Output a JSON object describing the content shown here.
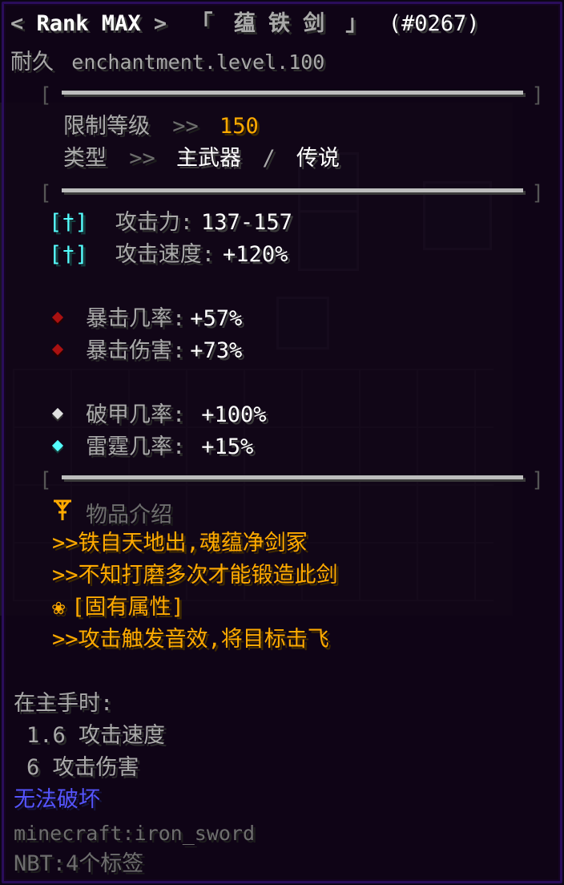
{
  "colors": {
    "gold": "#ffaa00",
    "gray": "#a9a9a9",
    "aqua": "#55ffff",
    "blue": "#5555ff",
    "red": "#aa0000",
    "frame": "#2a0d5a"
  },
  "header": {
    "left_arrow": "<",
    "rank": "Rank MAX",
    "right_arrow": ">",
    "bracket_open": "「",
    "name": "蕴 铁 剑",
    "bracket_close": "」",
    "id": "(#0267)"
  },
  "durability": {
    "label": "耐久",
    "value": "enchantment.level.100"
  },
  "requirements": {
    "level_label": "限制等级",
    "level_arrow": ">>",
    "level_value": "150",
    "type_label": "类型",
    "type_arrow": ">>",
    "type_value": "主武器",
    "type_sep": "/",
    "rarity_value": "传说"
  },
  "stats": [
    {
      "icon": "sword-icon",
      "glyph": "[†]",
      "label": "攻击力:",
      "value": "137-157"
    },
    {
      "icon": "sword-icon",
      "glyph": "[†]",
      "label": "攻击速度:",
      "value": "+120%"
    }
  ],
  "crit": [
    {
      "icon": "red-gem-icon",
      "label": "暴击几率:",
      "value": "+57%"
    },
    {
      "icon": "red-gem-icon",
      "label": "暴击伤害:",
      "value": "+73%"
    }
  ],
  "special": [
    {
      "icon": "white-gem-icon",
      "label": "破甲几率:",
      "value": "+100%"
    },
    {
      "icon": "aqua-gem-icon",
      "label": "雷霆几率:",
      "value": "+15%"
    }
  ],
  "description": {
    "title_icon": "emblem-icon",
    "title": "物品介绍",
    "lines": [
      ">>铁自天地出,魂蕴净剑冢",
      ">>不知打磨多次才能锻造此剑"
    ],
    "trait_icon": "flower-icon",
    "trait_glyph": "❀",
    "trait_title": "[固有属性]",
    "trait_lines": [
      ">>攻击触发音效,将目标击飞"
    ]
  },
  "mainhand": {
    "title": "在主手时:",
    "speed": "1.6 攻击速度",
    "damage": "6 攻击伤害"
  },
  "unbreakable": "无法破坏",
  "item_id": "minecraft:iron_sword",
  "nbt": "NBT:4个标签"
}
